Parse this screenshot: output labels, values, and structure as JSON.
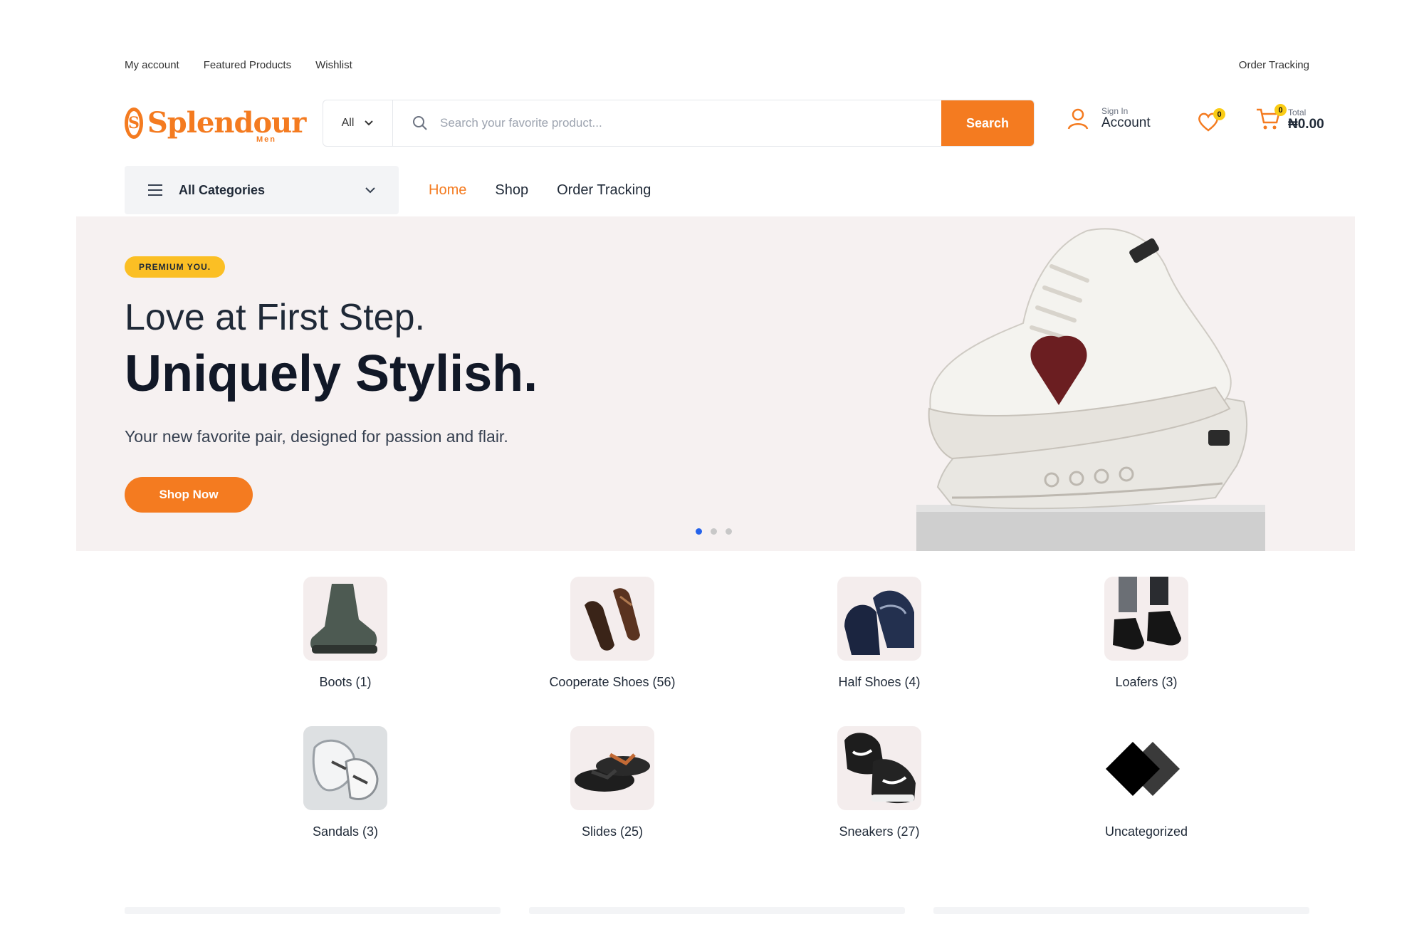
{
  "topbar": {
    "links": [
      "My account",
      "Featured Products",
      "Wishlist"
    ],
    "right_link": "Order Tracking"
  },
  "logo": {
    "text": "Splendour",
    "sub": "Men",
    "badge": "S"
  },
  "search": {
    "category": "All",
    "placeholder": "Search your favorite product...",
    "button": "Search"
  },
  "account": {
    "small": "Sign In",
    "label": "Account"
  },
  "wishlist": {
    "count": "0"
  },
  "cart": {
    "count": "0",
    "small": "Total",
    "total": "₦0.00"
  },
  "nav": {
    "all_categories": "All Categories",
    "menu": [
      "Home",
      "Shop",
      "Order Tracking"
    ],
    "active": "Home"
  },
  "hero": {
    "pill": "PREMIUM YOU.",
    "line1": "Love at First Step.",
    "line2": "Uniquely Stylish.",
    "description": "Your new favorite pair, designed for passion and flair.",
    "cta": "Shop Now",
    "slides": 3,
    "active_slide": 1
  },
  "categories": [
    {
      "label": "Boots (1)",
      "icon": "boot-image"
    },
    {
      "label": "Cooperate Shoes (56)",
      "icon": "cooperate-shoes-image"
    },
    {
      "label": "Half Shoes (4)",
      "icon": "half-shoes-image"
    },
    {
      "label": "Loafers (3)",
      "icon": "loafers-image"
    },
    {
      "label": "Sandals (3)",
      "icon": "sandals-image"
    },
    {
      "label": "Slides (25)",
      "icon": "slides-image"
    },
    {
      "label": "Sneakers (27)",
      "icon": "sneakers-image"
    },
    {
      "label": "Uncategorized",
      "icon": "uncategorized-image"
    }
  ],
  "colors": {
    "accent": "#f47b20",
    "pill": "#fbbf24",
    "hero_bg": "#f6f1f1",
    "active_dot": "#2563eb"
  }
}
